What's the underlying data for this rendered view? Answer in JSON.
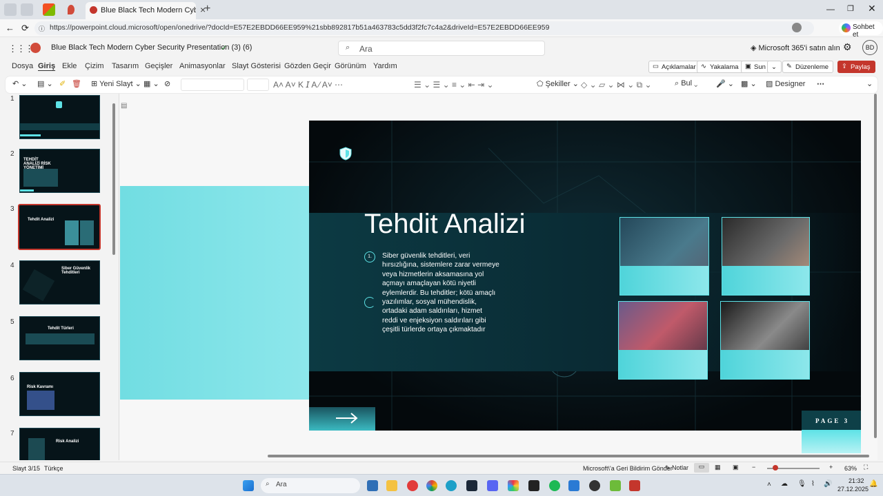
{
  "browser": {
    "tab_title": "Blue Black Tech Modern Cyber Sec",
    "url": "https://powerpoint.cloud.microsoft/open/onedrive/?docId=E57E2EBDD66EE959%21sbb892817b51a463783c5dd3f2fc7c4a2&driveId=E57E2EBDD66EE959",
    "copilot_label": "Sohbet et"
  },
  "app": {
    "doc_title": "Blue Black Tech Modern Cyber Security Presentation (3) (6)",
    "search_placeholder": "Ara",
    "buy_label": "Microsoft 365'i satın alın",
    "avatar_initials": "BD"
  },
  "menu": {
    "items": [
      "Dosya",
      "Giriş",
      "Ekle",
      "Çizim",
      "Tasarım",
      "Geçişler",
      "Animasyonlar",
      "Slayt Gösterisi",
      "Gözden Geçir",
      "Görünüm",
      "Yardım"
    ],
    "active": "Giriş",
    "comments": "Açıklamalar",
    "catchup": "Yakalama",
    "present": "Sun",
    "editing": "Düzenleme",
    "share": "Paylaş"
  },
  "ribbon": {
    "new_slide": "Yeni Slayt",
    "shapes": "Şekiller",
    "find": "Bul",
    "designer": "Designer"
  },
  "thumbnails": {
    "numbers": [
      "1",
      "2",
      "3",
      "4",
      "5",
      "6",
      "7"
    ],
    "titles": [
      "",
      "TEHDİT ANALİZİ RİSK YÖNETİMİ",
      "Tehdit Analizi",
      "Siber Güvenlik Tehditleri",
      "Tehdit Türleri",
      "Risk Kavramı",
      "Risk Analizi"
    ]
  },
  "slide": {
    "title": "Tehdit Analizi",
    "bullet_num": "1.",
    "body_text": "Siber güvenlik tehditleri, veri hırsızlığına, sistemlere zarar vermeye veya hizmetlerin aksamasına yol açmayı amaçlayan kötü niyetli eylemlerdir. Bu tehditler; kötü amaçlı yazılımlar, sosyal mühendislik, ortadaki adam saldırıları, hizmet reddi ve enjeksiyon saldırıları gibi çeşitli türlerde ortaya çıkmaktadır",
    "page_label": "PAGE 3",
    "accent": "#5ee2e6"
  },
  "status": {
    "slide_info": "Slayt 3/15",
    "language": "Türkçe",
    "feedback": "Microsoft\\'a Geri Bildirim Gönder",
    "notes": "Notlar",
    "zoom": "63%"
  },
  "taskbar": {
    "search": "Ara",
    "time": "21:32",
    "date": "27.12.2025"
  }
}
